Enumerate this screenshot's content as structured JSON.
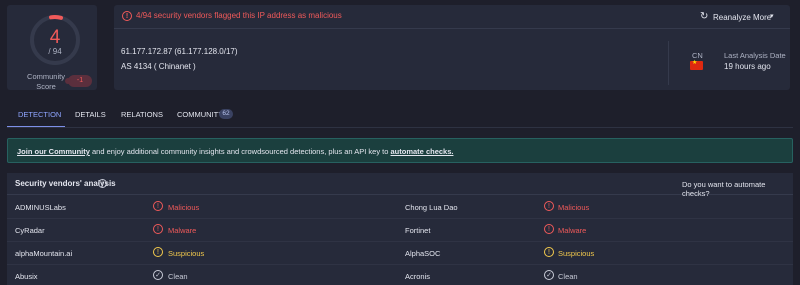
{
  "score": {
    "value": "4",
    "total": "/ 94",
    "community_label": "Community\nScore",
    "community_value": "-1",
    "accent": "#f05a5a"
  },
  "alert": {
    "text": "4/94 security vendors flagged this IP address as malicious",
    "icon": "alert-circle-icon"
  },
  "actions": {
    "reanalyze": "Reanalyze",
    "more": "More"
  },
  "ip": {
    "line": "61.177.172.87  (61.177.128.0/17)",
    "as": "AS 4134   ( Chinanet )"
  },
  "country": {
    "code": "CN",
    "flag_icon": "china-flag-icon"
  },
  "last_analysis": {
    "label": "Last Analysis Date",
    "value": "19 hours ago"
  },
  "tabs": [
    {
      "label": "DETECTION",
      "active": true
    },
    {
      "label": "DETAILS",
      "active": false
    },
    {
      "label": "RELATIONS",
      "active": false
    },
    {
      "label": "COMMUNITY",
      "active": false,
      "badge": "62"
    }
  ],
  "banner": {
    "link1": "Join our Community",
    "mid": " and enjoy additional community insights and crowdsourced detections, plus an API key to ",
    "link2": "automate checks."
  },
  "vendors": {
    "title": "Security vendors' analysis",
    "automate_question": "Do you want to automate checks?",
    "rows": [
      {
        "left": {
          "name": "ADMINUSLabs",
          "result": "Malicious",
          "status": "malicious"
        },
        "right": {
          "name": "Chong Lua Dao",
          "result": "Malicious",
          "status": "malicious"
        }
      },
      {
        "left": {
          "name": "CyRadar",
          "result": "Malware",
          "status": "malicious"
        },
        "right": {
          "name": "Fortinet",
          "result": "Malware",
          "status": "malicious"
        }
      },
      {
        "left": {
          "name": "alphaMountain.ai",
          "result": "Suspicious",
          "status": "suspicious"
        },
        "right": {
          "name": "AlphaSOC",
          "result": "Suspicious",
          "status": "suspicious"
        }
      },
      {
        "left": {
          "name": "Abusix",
          "result": "Clean",
          "status": "clean"
        },
        "right": {
          "name": "Acronis",
          "result": "Clean",
          "status": "clean"
        }
      }
    ]
  },
  "colors": {
    "background": "#1e1f2b",
    "panel": "#262a3a",
    "malicious": "#f05a5a",
    "suspicious": "#f2c94c",
    "clean": "#c9ccd8",
    "tab_active": "#8fa5ff",
    "banner": "#1b3f3e"
  }
}
